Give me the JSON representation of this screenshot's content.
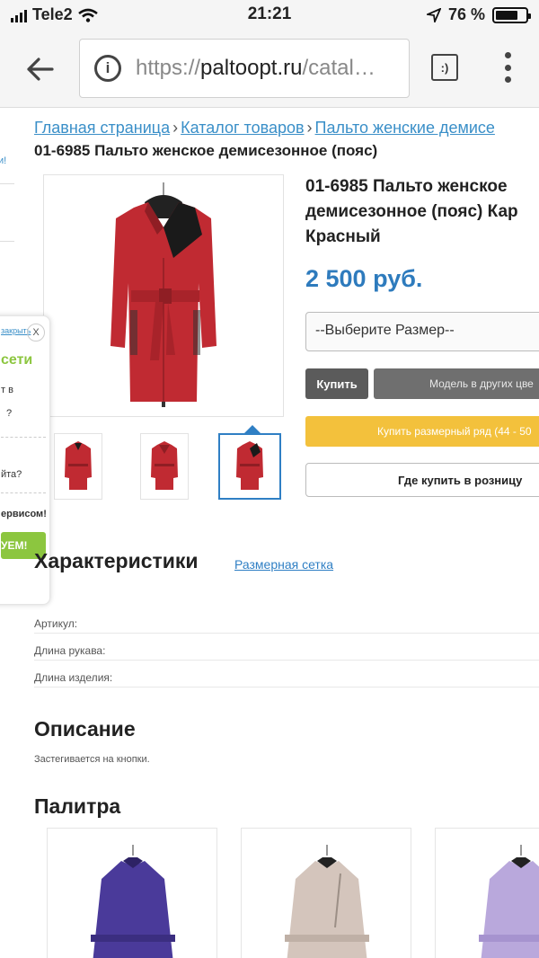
{
  "status_bar": {
    "carrier": "Tele2",
    "time": "21:21",
    "battery_percent": "76 %",
    "battery_level": 0.76
  },
  "browser": {
    "url_scheme": "https://",
    "url_domain": "paltoopt.ru",
    "url_rest": "/catal…",
    "reader_icon_text": ":)"
  },
  "breadcrumb": {
    "items": [
      "Главная страница",
      "Каталог товаров",
      "Пальто женские демисе"
    ],
    "separator": "›"
  },
  "page_title": "01-6985 Пальто женское демисезонное (пояс)",
  "product": {
    "title_lines": [
      "01-6985 Пальто женское",
      "демисезонное (пояс) Кар",
      "Красный"
    ],
    "price": "2 500 руб.",
    "size_select": "--Выберите Размер--",
    "buy_label": "Купить",
    "other_colors_label": "Модель в других цве",
    "buy_row_label": "Купить размерный ряд (44 - 50",
    "retail_label": "Где купить в розницу"
  },
  "widget": {
    "close_label": "закрыть",
    "close_x": "X",
    "title": "сети",
    "lines": [
      "т в",
      "?",
      "йта?",
      "ервисом!"
    ],
    "cta": "УЕМ!"
  },
  "left_strip": {
    "text": "и!"
  },
  "characteristics": {
    "heading": "Характеристики",
    "size_chart_link": "Размерная сетка",
    "rows": [
      "Артикул:",
      "Длина рукава:",
      "Длина изделия:"
    ]
  },
  "description": {
    "heading": "Описание",
    "text": "Застегивается на кнопки."
  },
  "palette": {
    "heading": "Палитра"
  },
  "colors": {
    "accent_blue": "#2e7bbd",
    "buy_row_yellow": "#f3c13c",
    "coat_red": "#c02a32",
    "widget_green": "#8cc63f",
    "palette_colors": [
      "#4a3a9a",
      "#d4c5bc",
      "#b9a8dc"
    ]
  }
}
